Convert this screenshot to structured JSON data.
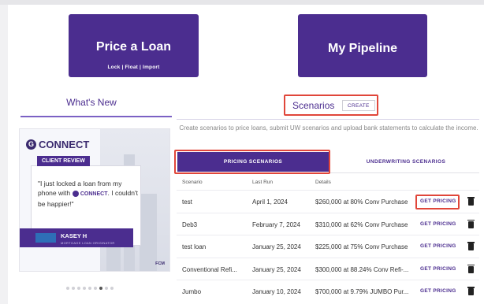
{
  "actions": {
    "price_loan": {
      "title": "Price a Loan",
      "sub": "Lock | Float | Import"
    },
    "pipeline": {
      "title": "My Pipeline"
    }
  },
  "whats_new": {
    "heading": "What's New",
    "promo": {
      "brand": "CONNECT",
      "badge": "CLIENT REVIEW",
      "quote_1": "\"I just locked a loan from my phone with",
      "quote_brand": "CONNECT",
      "quote_2": ". I couldn't be happier!\"",
      "person": "KASEY H",
      "person_title": "MORTGAGE LOAN ORIGINATOR",
      "footer": "FCM"
    },
    "dots_total": 9,
    "dot_active": 7
  },
  "scenarios": {
    "heading": "Scenarios",
    "create_label": "CREATE",
    "description": "Create scenarios to price loans, submit UW scenarios and upload bank statements to calculate the income.",
    "tabs": [
      {
        "label": "PRICING SCENARIOS",
        "active": true
      },
      {
        "label": "UNDERWRITING SCENARIOS",
        "active": false
      }
    ],
    "columns": [
      "Scenario",
      "Last Run",
      "Details"
    ],
    "action_label": "GET PRICING",
    "rows": [
      {
        "scenario": "test",
        "last_run": "April 1, 2024",
        "details": "$260,000 at 80% Conv Purchase"
      },
      {
        "scenario": "Deb3",
        "last_run": "February 7, 2024",
        "details": "$310,000 at 62% Conv Purchase"
      },
      {
        "scenario": "test loan",
        "last_run": "January 25, 2024",
        "details": "$225,000 at 75% Conv Purchase"
      },
      {
        "scenario": "Conventional Refi...",
        "last_run": "January 25, 2024",
        "details": "$300,000 at 88.24% Conv Refi-..."
      },
      {
        "scenario": "Jumbo",
        "last_run": "January 10, 2024",
        "details": "$700,000 at 9.79% JUMBO Pur..."
      }
    ]
  },
  "colors": {
    "primary": "#4b2d8f",
    "highlight": "#e0463a"
  }
}
